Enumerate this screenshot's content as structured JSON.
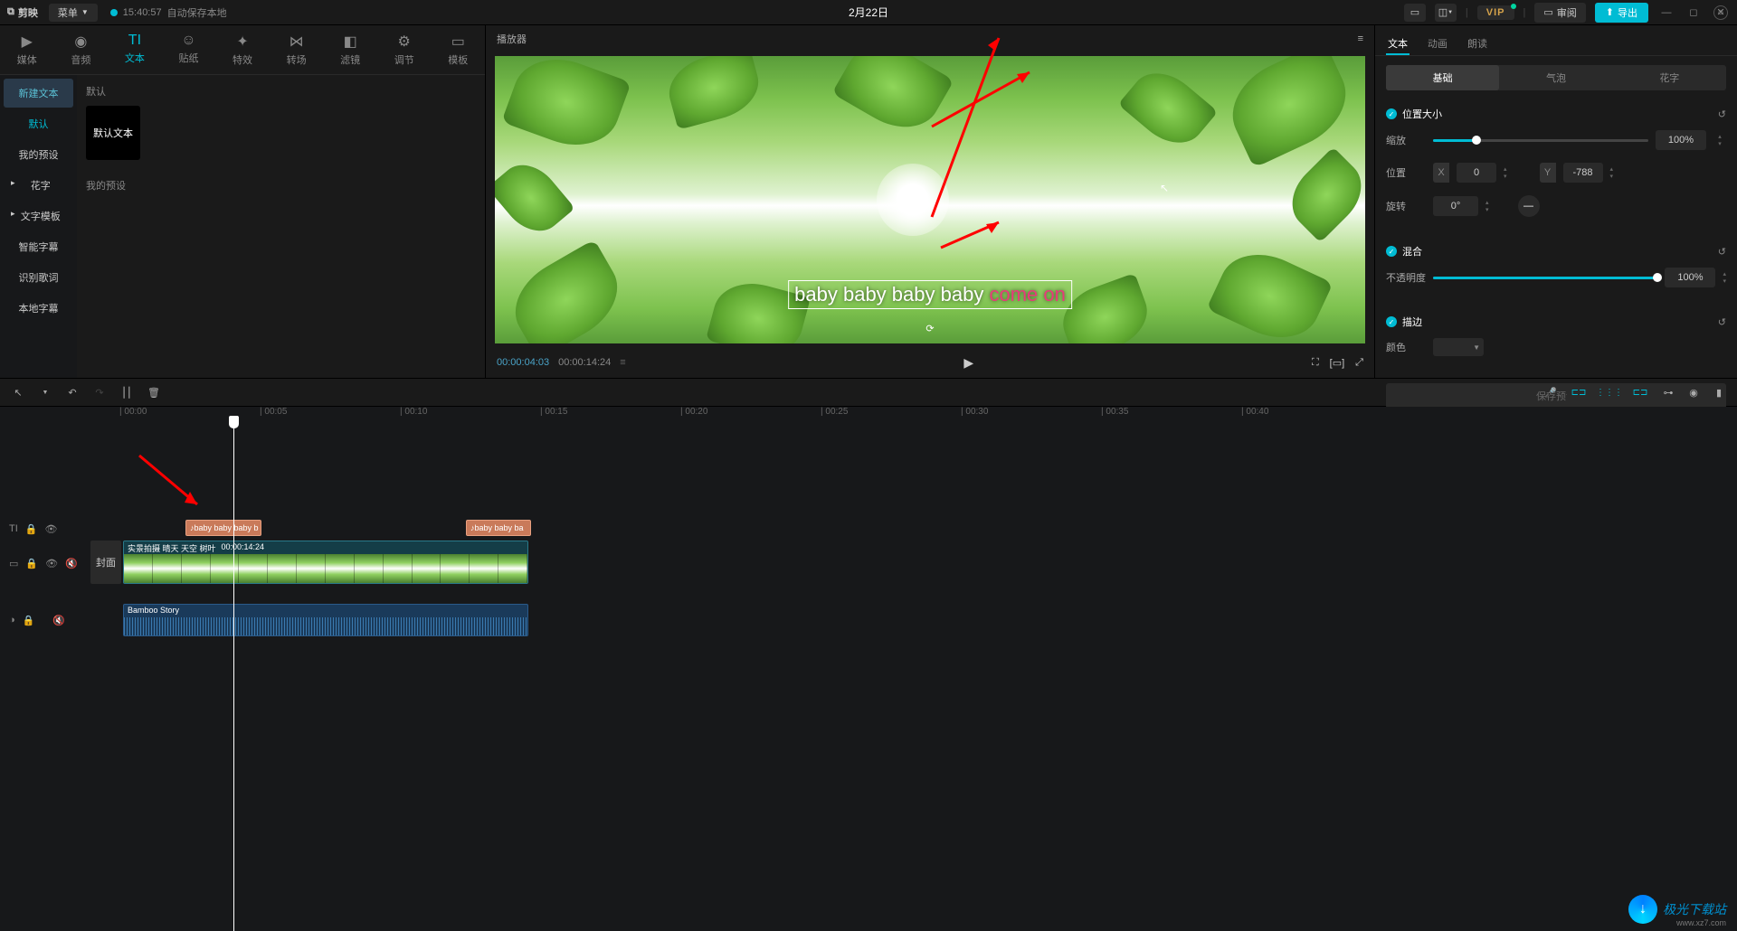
{
  "titlebar": {
    "app_name": "剪映",
    "menu": "菜单",
    "autosave_time": "15:40:57",
    "autosave_text": "自动保存本地",
    "project_title": "2月22日",
    "vip": "VIP",
    "review": "审阅",
    "export": "导出"
  },
  "left_tabs": [
    {
      "label": "媒体",
      "icon": "▶"
    },
    {
      "label": "音频",
      "icon": "◉"
    },
    {
      "label": "文本",
      "icon": "TI",
      "active": true
    },
    {
      "label": "贴纸",
      "icon": "☺"
    },
    {
      "label": "特效",
      "icon": "✦"
    },
    {
      "label": "转场",
      "icon": "⋈"
    },
    {
      "label": "滤镜",
      "icon": "◧"
    },
    {
      "label": "调节",
      "icon": "⚙"
    },
    {
      "label": "模板",
      "icon": "▭"
    }
  ],
  "left_sidebar": {
    "new_text": "新建文本",
    "items": [
      "默认",
      "我的预设",
      "花字",
      "文字模板",
      "智能字幕",
      "识别歌词",
      "本地字幕"
    ]
  },
  "left_content": {
    "section1": "默认",
    "preset_label": "默认文本",
    "section2": "我的预设"
  },
  "player": {
    "title": "播放器",
    "subtitle_plain": "baby baby baby baby",
    "subtitle_highlight": "come on",
    "current_time": "00:00:04:03",
    "duration": "00:00:14:24"
  },
  "right_tabs": [
    "文本",
    "动画",
    "朗读"
  ],
  "sub_tabs": [
    "基础",
    "气泡",
    "花字"
  ],
  "props": {
    "pos_size": {
      "title": "位置大小",
      "scale_label": "缩放",
      "scale_value": "100%",
      "pos_label": "位置",
      "x_label": "X",
      "x_value": "0",
      "y_label": "Y",
      "y_value": "-788",
      "rotate_label": "旋转",
      "rotate_value": "0°"
    },
    "blend": {
      "title": "混合",
      "opacity_label": "不透明度",
      "opacity_value": "100%"
    },
    "stroke": {
      "title": "描边",
      "color_label": "颜色"
    },
    "save_preset": "保存预设"
  },
  "timeline": {
    "ticks": [
      "00:00",
      "00:05",
      "00:10",
      "00:15",
      "00:20",
      "00:25",
      "00:30",
      "00:35",
      "00:40"
    ],
    "text_clip1": "baby baby baby b",
    "text_clip2": "baby baby ba",
    "video_clip_name": "实景拍摄 晴天 天空 树叶",
    "video_clip_dur": "00:00:14:24",
    "cover": "封面",
    "audio_clip_name": "Bamboo Story"
  },
  "watermark": {
    "name": "极光下载站",
    "url": "www.xz7.com"
  }
}
